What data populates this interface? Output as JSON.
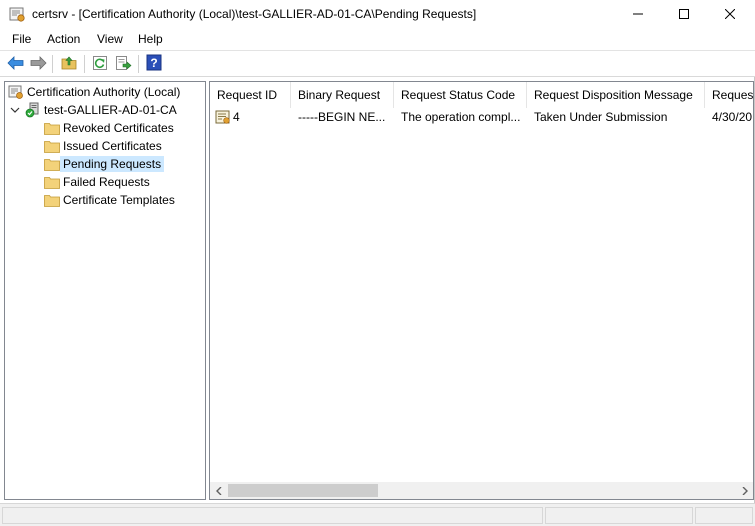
{
  "window": {
    "title": "certsrv - [Certification Authority (Local)\\test-GALLIER-AD-01-CA\\Pending Requests]",
    "app_icon": "certsrv-icon",
    "controls": {
      "minimize": "minimize-icon",
      "maximize": "maximize-icon",
      "close": "close-icon"
    }
  },
  "menu": {
    "file": "File",
    "action": "Action",
    "view": "View",
    "help": "Help"
  },
  "toolbar": {
    "buttons": [
      "back-arrow-icon",
      "forward-arrow-icon",
      "up-folder-icon",
      "refresh-icon",
      "export-list-icon",
      "help-icon"
    ]
  },
  "tree": {
    "root": "Certification Authority (Local)",
    "ca": "test-GALLIER-AD-01-CA",
    "folders": [
      "Revoked Certificates",
      "Issued Certificates",
      "Pending Requests",
      "Failed Requests",
      "Certificate Templates"
    ],
    "selected": "Pending Requests"
  },
  "list": {
    "columns": [
      "Request ID",
      "Binary Request",
      "Request Status Code",
      "Request Disposition Message",
      "Request"
    ],
    "rows": [
      {
        "request_id": "4",
        "binary_request": "-----BEGIN NE...",
        "status_code": "The operation compl...",
        "disposition": "Taken Under Submission",
        "request_date": "4/30/20"
      }
    ]
  },
  "colors": {
    "selection": "#cce8ff",
    "folder": "#e8c25e",
    "accent_blue": "#2c7bd6"
  }
}
